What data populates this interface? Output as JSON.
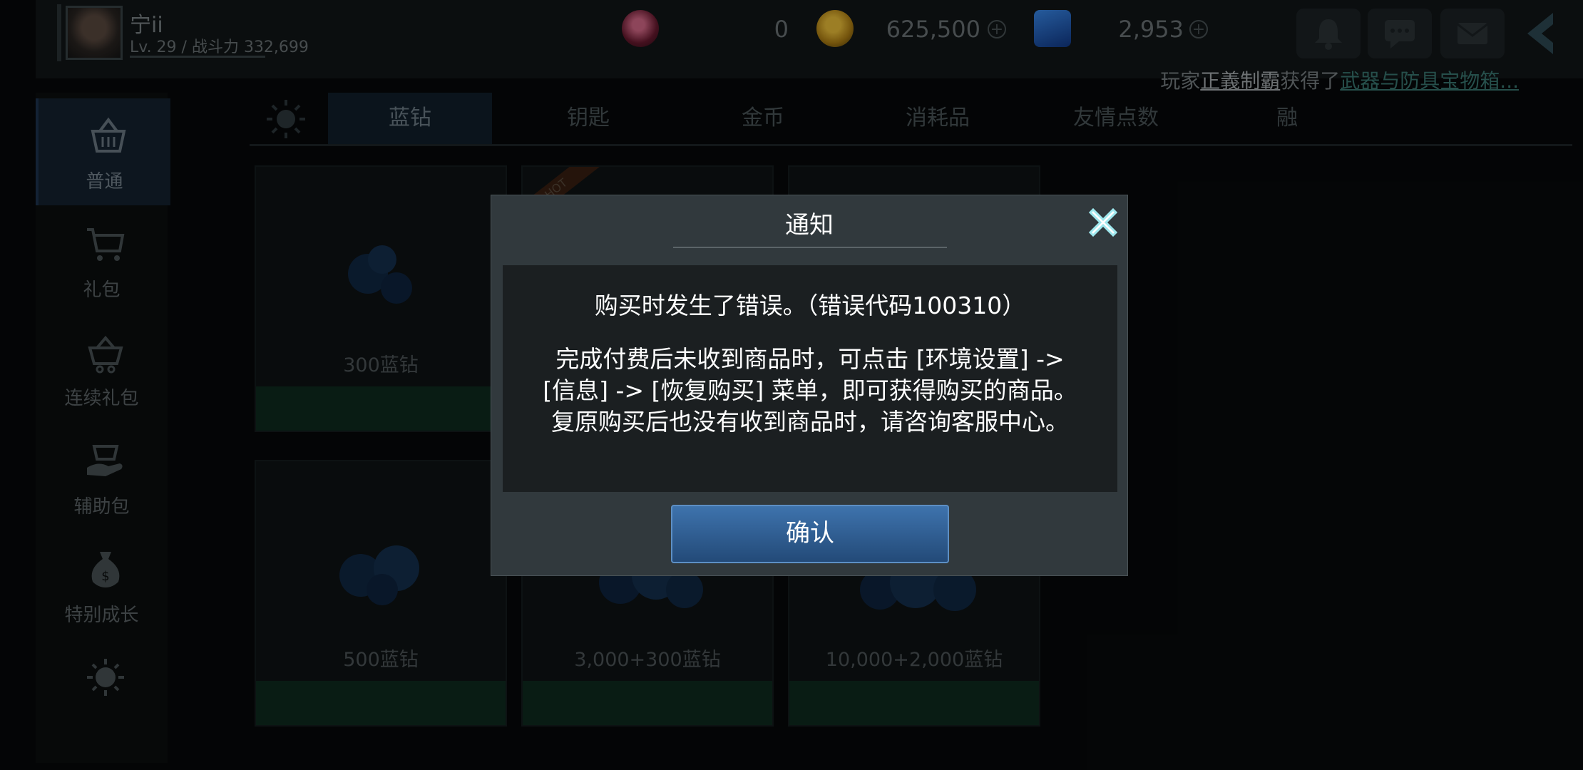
{
  "player": {
    "name": "宁ii",
    "level_power": "Lv. 29 / 战斗力 332,699"
  },
  "resources": {
    "keys": "0",
    "gold": "625,500",
    "diamonds": "2,953",
    "plus_glyph": "+"
  },
  "broadcast": {
    "prefix": "玩家",
    "player": "正義制霸",
    "middle": "获得了",
    "item": "武器与防具宝物箱..."
  },
  "nav": {
    "items": [
      {
        "label": "普通",
        "icon": "basket-icon"
      },
      {
        "label": "礼包",
        "icon": "cart-icon"
      },
      {
        "label": "连续礼包",
        "icon": "basket-chain-icon"
      },
      {
        "label": "辅助包",
        "icon": "hand-gift-icon"
      },
      {
        "label": "特别成长",
        "icon": "money-bag-icon"
      },
      {
        "label": "",
        "icon": "sun-icon"
      }
    ]
  },
  "tabs": [
    "蓝钻",
    "钥匙",
    "金币",
    "消耗品",
    "友情点数",
    "融"
  ],
  "products": [
    {
      "label": "300蓝钻"
    },
    {
      "label": ""
    },
    {
      "label": ""
    },
    {
      "label": "500蓝钻"
    },
    {
      "label": "3,000+300蓝钻"
    },
    {
      "label": "10,000+2,000蓝钻"
    }
  ],
  "hot_badge": "HOT",
  "dialog": {
    "title": "通知",
    "line1": "购买时发生了错误。（错误代码100310）",
    "line2": "完成付费后未收到商品时，可点击 [环境设置] -> [信息] -> [恢复购买] 菜单，即可获得购买的商品。复原购买后也没有收到商品时，请咨询客服中心。",
    "confirm": "确认"
  },
  "colors": {
    "confirm_button": "#2f5f94",
    "close_icon": "#bff4f6",
    "active_tab": "#12202c"
  }
}
